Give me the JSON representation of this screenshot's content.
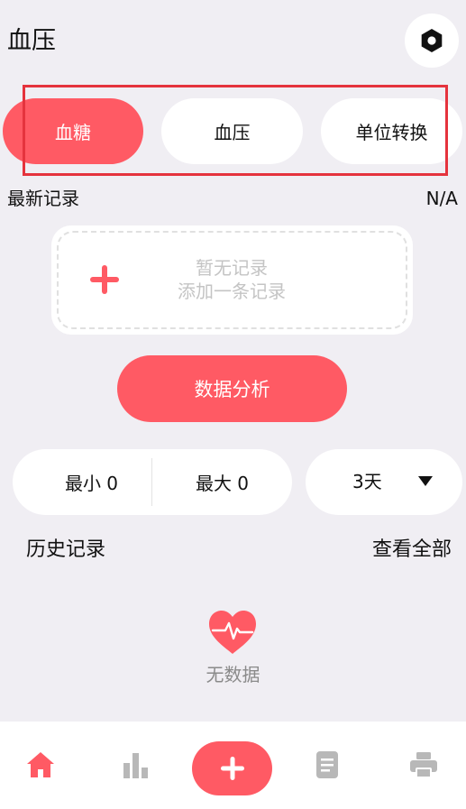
{
  "header": {
    "title": "血压"
  },
  "tabs": [
    {
      "label": "血糖",
      "active": true
    },
    {
      "label": "血压",
      "active": false
    },
    {
      "label": "单位转换",
      "active": false
    }
  ],
  "latest": {
    "label": "最新记录",
    "value": "N/A"
  },
  "empty_card": {
    "line1": "暂无记录",
    "line2": "添加一条记录"
  },
  "analysis_button": "数据分析",
  "stats": {
    "min": "最小 0",
    "max": "最大 0"
  },
  "range": {
    "selected": "3天"
  },
  "history": {
    "label": "历史记录",
    "view_all": "查看全部"
  },
  "no_data": "无数据",
  "colors": {
    "accent": "#ff5a64",
    "background": "#f0eef3",
    "highlight_border": "#e5333d",
    "icon_gray": "#b8b8b8"
  },
  "icons": {
    "settings": "hexagon-gear-icon",
    "add": "plus-icon",
    "heart": "heart-pulse-icon",
    "caret": "caret-down-icon",
    "nav": [
      "home-icon",
      "bar-chart-icon",
      "plus-icon",
      "document-icon",
      "printer-icon"
    ]
  }
}
